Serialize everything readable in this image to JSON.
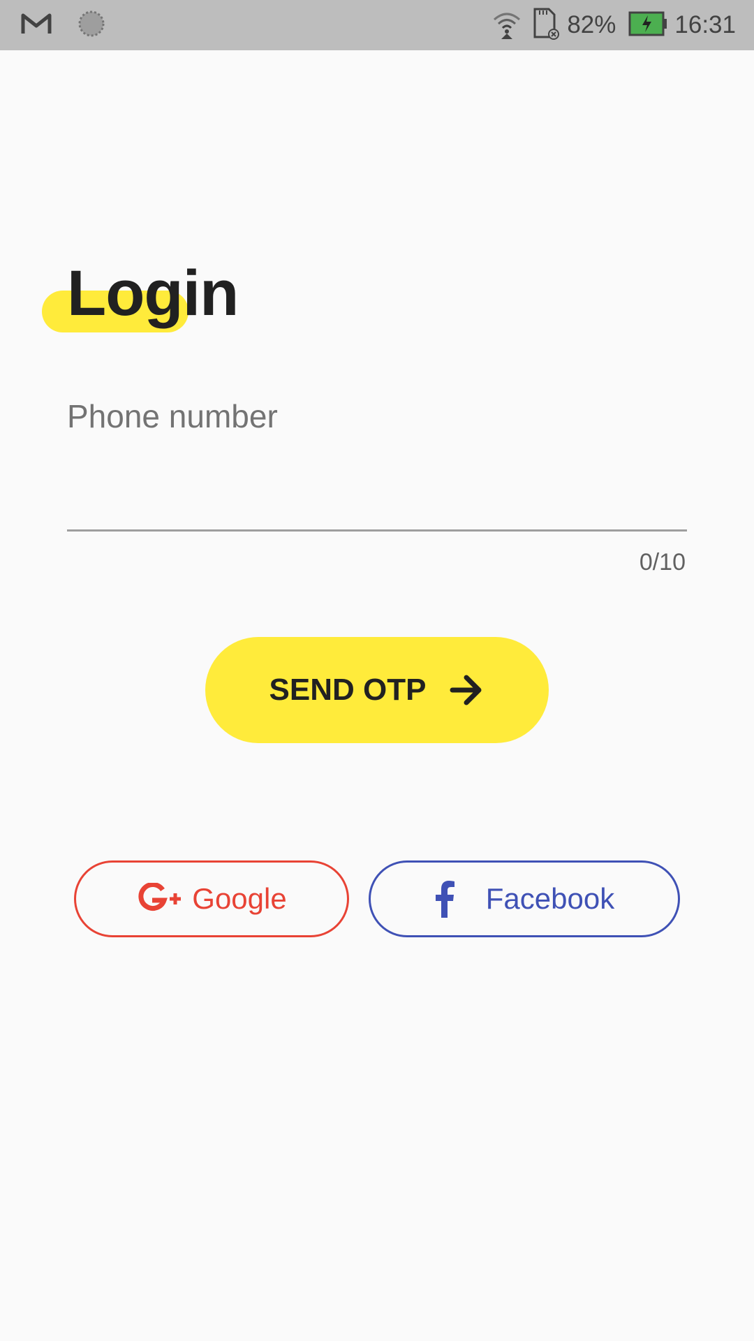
{
  "status_bar": {
    "battery_percent": "82%",
    "time": "16:31",
    "icons": [
      "gmail-icon",
      "sync-icon",
      "wifi-icon",
      "sd-card-icon",
      "battery-icon"
    ],
    "battery_color": "#4caf50"
  },
  "login": {
    "title": "Login",
    "highlight_color": "#ffeb3b",
    "phone_placeholder": "Phone number",
    "phone_value": "",
    "counter": "0/10",
    "send_otp_label": "SEND OTP",
    "send_otp_icon": "arrow-right-icon"
  },
  "social": {
    "google_label": "Google",
    "google_icon": "google-plus-icon",
    "google_color": "#e84335",
    "facebook_label": "Facebook",
    "facebook_icon": "facebook-icon",
    "facebook_color": "#3f51b5"
  }
}
